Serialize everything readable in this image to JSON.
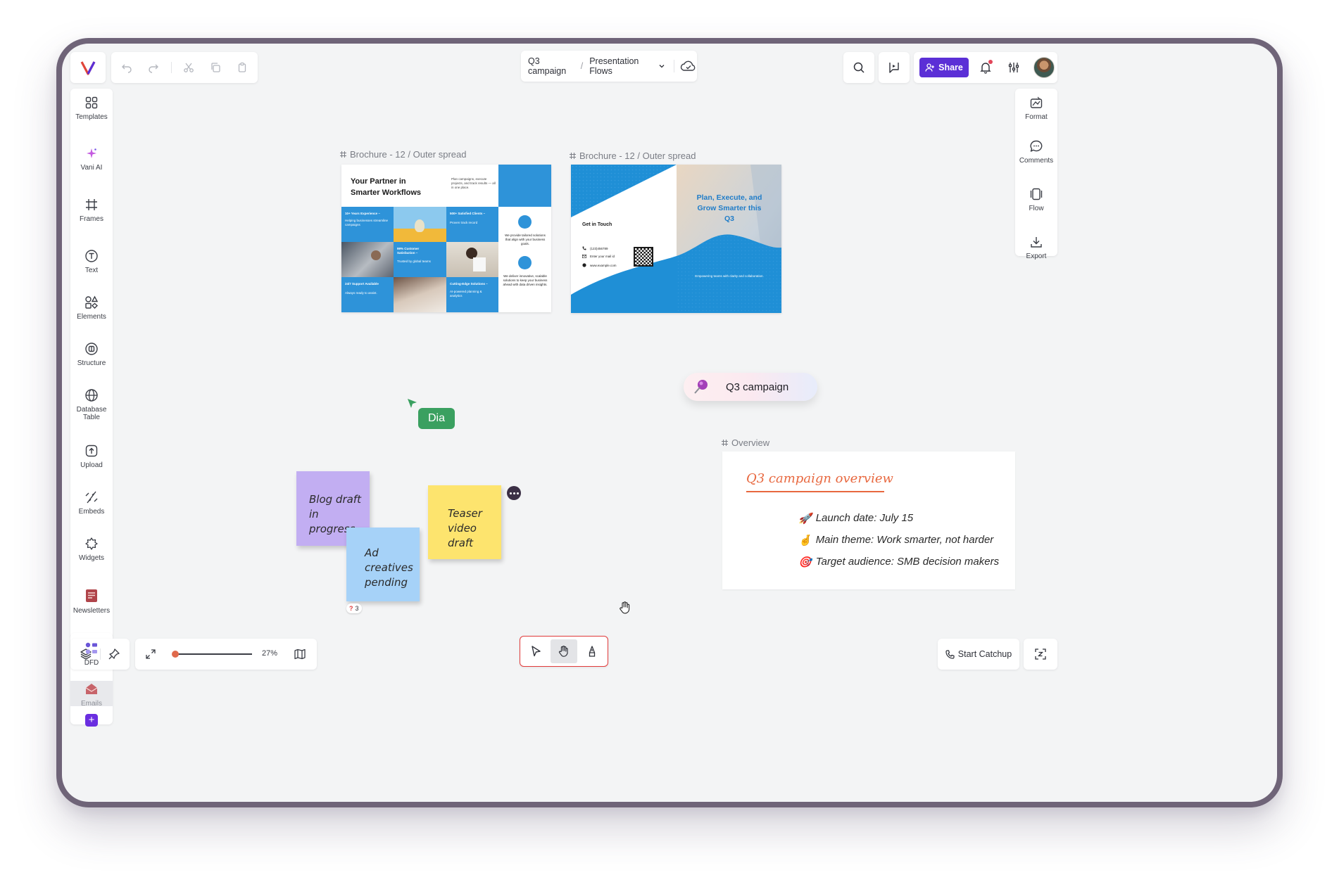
{
  "topbar": {
    "breadcrumb_project": "Q3 campaign",
    "breadcrumb_sep": "/",
    "breadcrumb_page": "Presentation Flows",
    "share_label": "Share"
  },
  "left_sidebar": {
    "items": [
      {
        "label": "Templates",
        "icon": "templates-icon"
      },
      {
        "label": "Vani AI",
        "icon": "sparkle-icon"
      },
      {
        "label": "Frames",
        "icon": "frame-icon"
      },
      {
        "label": "Text",
        "icon": "text-icon"
      },
      {
        "label": "Elements",
        "icon": "shapes-icon"
      },
      {
        "label": "Structure",
        "icon": "structure-icon"
      },
      {
        "label": "Database Table",
        "icon": "globe-icon"
      },
      {
        "label": "Upload",
        "icon": "upload-icon"
      },
      {
        "label": "Embeds",
        "icon": "embed-icon"
      },
      {
        "label": "Widgets",
        "icon": "widgets-icon"
      },
      {
        "label": "Newsletters",
        "icon": "newsletter-icon"
      },
      {
        "label": "DFD",
        "icon": "dfd-icon"
      },
      {
        "label": "Emails",
        "icon": "email-icon"
      }
    ]
  },
  "right_sidebar": {
    "items": [
      {
        "label": "Format",
        "icon": "format-icon"
      },
      {
        "label": "Comments",
        "icon": "comment-icon"
      },
      {
        "label": "Flow",
        "icon": "flow-icon"
      },
      {
        "label": "Export",
        "icon": "download-icon"
      }
    ]
  },
  "canvas": {
    "frame1_label": "Brochure - 12 / Outer spread",
    "frame2_label": "Brochure - 12 / Outer spread",
    "brochure1": {
      "headline": "Your Partner in Smarter Workflows",
      "intro": "Plan campaigns, execute projects, and track results — all in one place.",
      "tile1_title": "10+ Years Experience –",
      "tile1_body": "Helping businesses streamline campaigns",
      "tile2_title": "500+ Satisfied Clients –",
      "tile2_body": "Proven track record",
      "tile3_title": "99% Customer Satisfaction –",
      "tile3_body": "Trusted by global teams",
      "tile4_title": "24/7 Support Available",
      "tile4_body": "Always ready to assist.",
      "tile5_title": "Cutting-Edge Solutions –",
      "tile5_body": "AI-powered planning & analytics",
      "side_text1": "We provide tailored solutions that align with your business goals.",
      "side_text2": "We deliver innovative, scalable solutions to keep your business ahead with data driven insights."
    },
    "brochure2": {
      "contact_title": "Get in Touch",
      "phone": "(123)456789",
      "email": "Enter your mail id",
      "website": "www.example.com",
      "headline": "Plan, Execute, and Grow Smarter this Q3",
      "tagline": "Empowering teams with clarity and collaboration."
    },
    "cursor_user": "Dia",
    "campaign_chip": "Q3 campaign",
    "overview_label": "Overview",
    "overview": {
      "title": "Q3 campaign overview",
      "items": [
        {
          "emoji": "🚀",
          "text": "Launch date: July 15"
        },
        {
          "emoji": "🤞",
          "text": "Main theme: Work smarter, not harder"
        },
        {
          "emoji": "🎯",
          "text": "Target audience: SMB decision makers"
        }
      ]
    },
    "stickies": {
      "purple": "Blog draft in progress",
      "blue": "Ad creatives pending",
      "yellow": "Teaser video draft",
      "reaction_count": "3"
    }
  },
  "bottombar": {
    "zoom_label": "27%",
    "zoom_level": 0.27,
    "catchup_label": "Start Catchup"
  },
  "colors": {
    "accent": "#5b2fd6",
    "sticky_purple": "#c2aef2",
    "sticky_blue": "#a6d2f8",
    "sticky_yellow": "#fde46e",
    "brochure_blue": "#1f8fd6",
    "dia_green": "#3aa060",
    "highlight_red": "#e23b3b",
    "overview_title": "#e8683f"
  }
}
